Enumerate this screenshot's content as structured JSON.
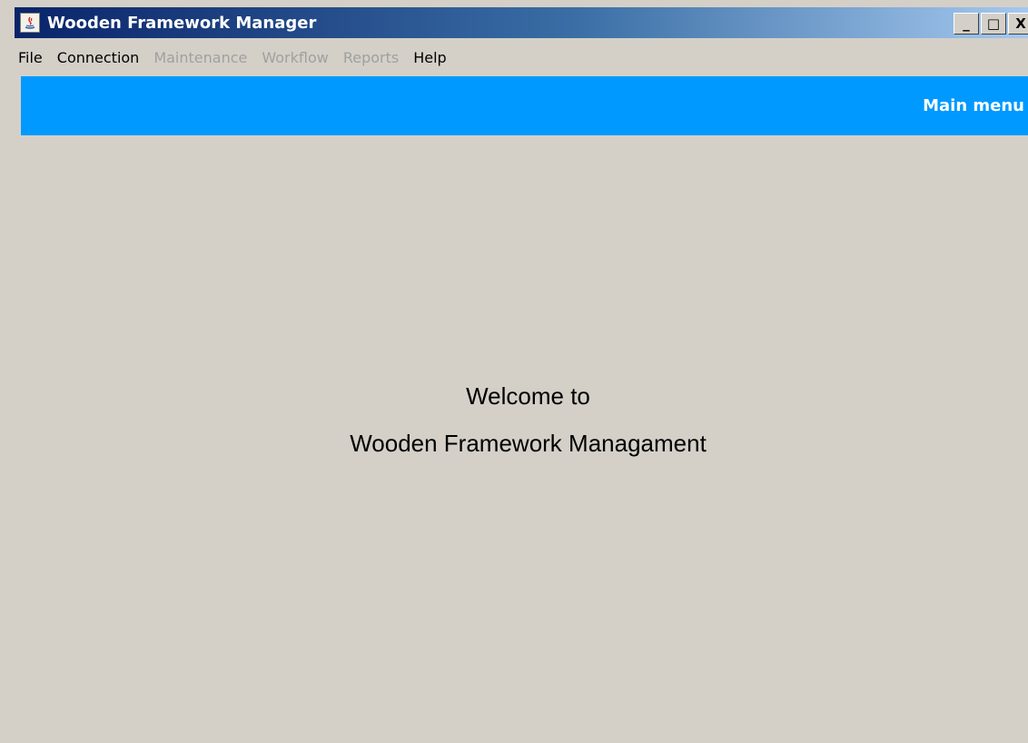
{
  "window": {
    "title": "Wooden Framework Manager",
    "icon": "java-app-icon",
    "buttons": {
      "minimize": "_",
      "maximize": "□",
      "close": "X"
    }
  },
  "menu": {
    "items": [
      {
        "label": "File",
        "enabled": true
      },
      {
        "label": "Connection",
        "enabled": true
      },
      {
        "label": "Maintenance",
        "enabled": false
      },
      {
        "label": "Workflow",
        "enabled": false
      },
      {
        "label": "Reports",
        "enabled": false
      },
      {
        "label": "Help",
        "enabled": true
      }
    ]
  },
  "header": {
    "title": "Main menu",
    "color": "#0099ff"
  },
  "welcome": {
    "line1": "Welcome to",
    "line2": "Wooden Framework Managament"
  }
}
